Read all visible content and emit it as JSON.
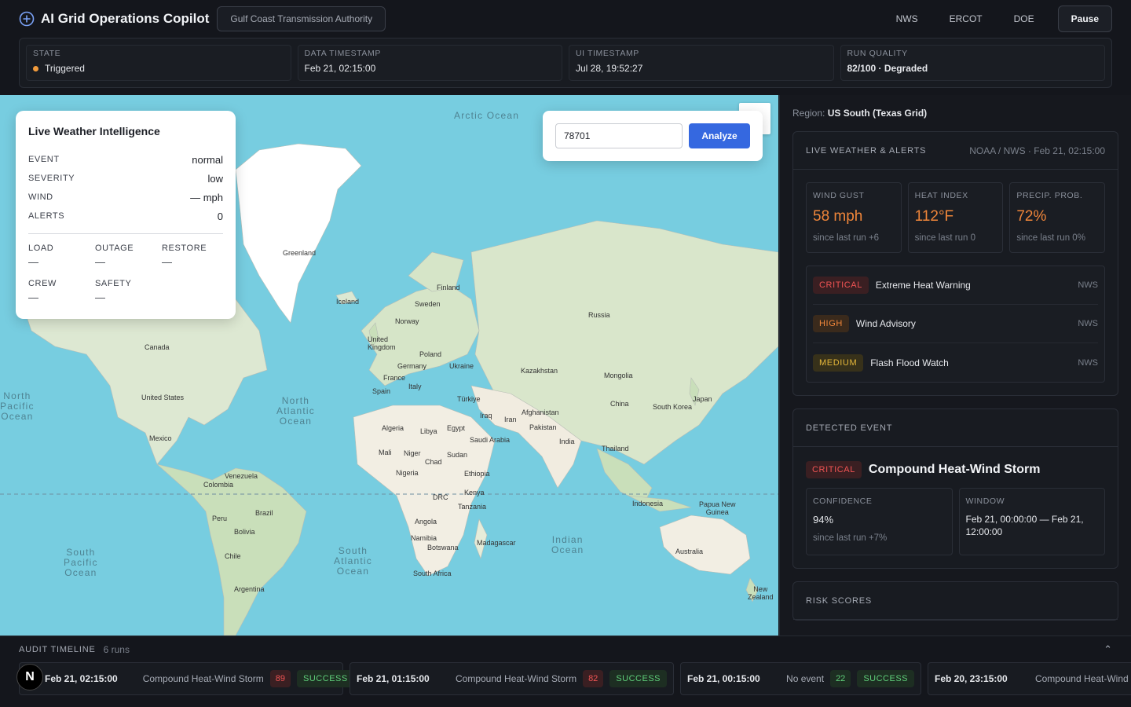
{
  "header": {
    "title": "AI Grid Operations Copilot",
    "org": "Gulf Coast Transmission Authority",
    "links": [
      "NWS",
      "ERCOT",
      "DOE"
    ],
    "pause_label": "Pause"
  },
  "status": {
    "state_label": "STATE",
    "state_value": "Triggered",
    "data_ts_label": "DATA TIMESTAMP",
    "data_ts_value": "Feb 21, 02:15:00",
    "ui_ts_label": "UI TIMESTAMP",
    "ui_ts_value": "Jul 28, 19:52:27",
    "quality_label": "RUN QUALITY",
    "quality_value": "82/100 · Degraded"
  },
  "weather_card": {
    "title": "Live Weather Intelligence",
    "rows": [
      {
        "key": "EVENT",
        "value": "normal"
      },
      {
        "key": "SEVERITY",
        "value": "low"
      },
      {
        "key": "WIND",
        "value": "— mph"
      },
      {
        "key": "ALERTS",
        "value": "0"
      }
    ],
    "grid": [
      {
        "key": "LOAD",
        "value": "—"
      },
      {
        "key": "OUTAGE",
        "value": "—"
      },
      {
        "key": "RESTORE",
        "value": "—"
      },
      {
        "key": "CREW",
        "value": "—"
      },
      {
        "key": "SAFETY",
        "value": "—"
      }
    ]
  },
  "search": {
    "zip_value": "78701",
    "analyze_label": "Analyze"
  },
  "map_labels": {
    "oceans": [
      "Arctic Ocean",
      "North\nPacific\nOcean",
      "North\nAtlantic\nOcean",
      "South\nPacific\nOcean",
      "South\nAtlantic\nOcean",
      "Indian\nOcean"
    ],
    "places": [
      "Greenland",
      "Iceland",
      "Finland",
      "Sweden",
      "Norway",
      "United\nKingdom",
      "Poland",
      "Germany",
      "Ukraine",
      "France",
      "Italy",
      "Spain",
      "Russia",
      "Kazakhstan",
      "Mongolia",
      "China",
      "South Korea",
      "Japan",
      "Türkiye",
      "Iraq",
      "Iran",
      "Afghanistan",
      "Pakistan",
      "India",
      "Thailand",
      "Saudi Arabia",
      "Egypt",
      "Libya",
      "Algeria",
      "Mali",
      "Niger",
      "Chad",
      "Sudan",
      "Ethiopia",
      "Nigeria",
      "DRC",
      "Kenya",
      "Tanzania",
      "Angola",
      "Namibia",
      "Botswana",
      "South Africa",
      "Madagascar",
      "Indonesia",
      "Papua New\nGuinea",
      "Australia",
      "New\nZealand",
      "Canada",
      "United States",
      "Mexico",
      "Venezuela",
      "Colombia",
      "Peru",
      "Brazil",
      "Bolivia",
      "Chile",
      "Argentina"
    ]
  },
  "right": {
    "region_label": "Region:",
    "region_value": "US South (Texas Grid)",
    "weather_section": {
      "title": "LIVE WEATHER & ALERTS",
      "meta": "NOAA / NWS · Feb 21, 02:15:00",
      "metrics": [
        {
          "label": "WIND GUST",
          "value": "58 mph",
          "delta": "since last run +6"
        },
        {
          "label": "HEAT INDEX",
          "value": "112°F",
          "delta": "since last run 0"
        },
        {
          "label": "PRECIP. PROB.",
          "value": "72%",
          "delta": "since last run 0%"
        }
      ],
      "alerts": [
        {
          "severity": "CRITICAL",
          "name": "Extreme Heat Warning",
          "source": "NWS"
        },
        {
          "severity": "HIGH",
          "name": "Wind Advisory",
          "source": "NWS"
        },
        {
          "severity": "MEDIUM",
          "name": "Flash Flood Watch",
          "source": "NWS"
        }
      ]
    },
    "event_section": {
      "title": "DETECTED EVENT",
      "severity": "CRITICAL",
      "name": "Compound Heat-Wind Storm",
      "confidence_label": "CONFIDENCE",
      "confidence_value": "94%",
      "confidence_delta": "since last run +7%",
      "window_label": "WINDOW",
      "window_value": "Feb 21, 00:00:00 — Feb 21, 12:00:00"
    },
    "risk_section": {
      "title": "RISK SCORES"
    }
  },
  "timeline": {
    "title": "AUDIT TIMELINE",
    "count": "6 runs",
    "runs": [
      {
        "time": "Feb 21, 02:15:00",
        "event": "Compound Heat-Wind Storm",
        "score": "89",
        "status": "SUCCESS"
      },
      {
        "time": "Feb 21, 01:15:00",
        "event": "Compound Heat-Wind Storm",
        "score": "82",
        "status": "SUCCESS"
      },
      {
        "time": "Feb 21, 00:15:00",
        "event": "No event",
        "score": "22",
        "status": "SUCCESS"
      },
      {
        "time": "Feb 20, 23:15:00",
        "event": "Compound Heat-Wind Storm",
        "score": "",
        "status": ""
      }
    ]
  },
  "badge": "N",
  "colors": {
    "accent": "#3568e0",
    "critical": "#f05454",
    "high": "#f0863a",
    "medium": "#e5b73a",
    "success": "#5fcf7a"
  }
}
